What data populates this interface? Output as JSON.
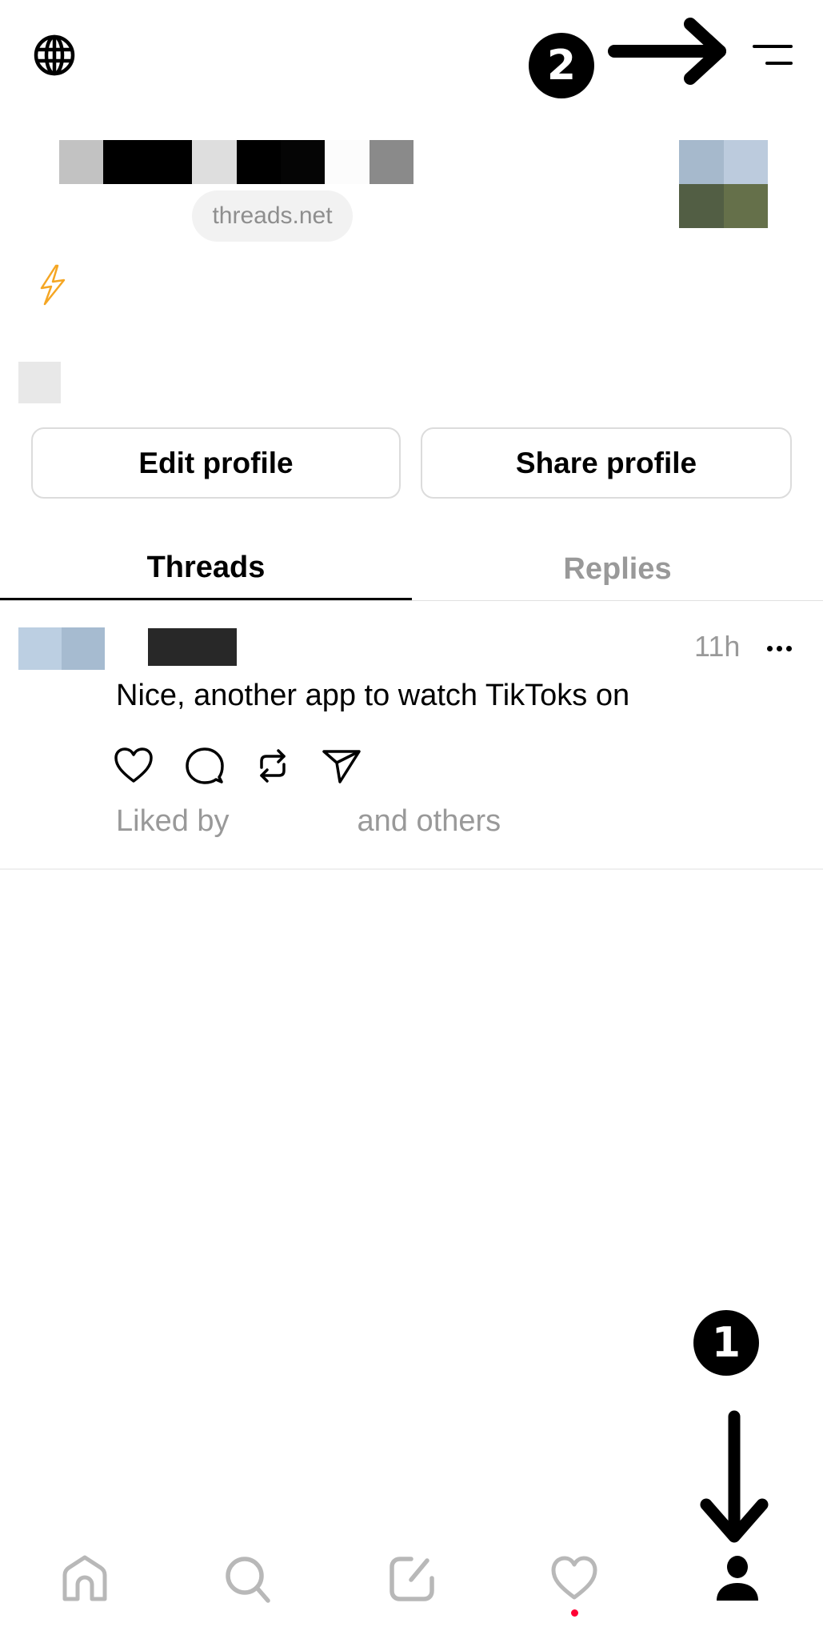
{
  "header": {
    "globe_icon": "globe-icon",
    "menu_icon": "menu-icon"
  },
  "profile": {
    "domain_label": "threads.net",
    "name_redacted_colors": [
      "#c2c2c2",
      "#000000",
      "#000000",
      "#dedede",
      "#000000",
      "#050505",
      "#fcfcfc",
      "#8a8a8a"
    ],
    "avatar_colors": [
      "#a6b9cc",
      "#bccbdd",
      "#525e44",
      "#65704a"
    ],
    "bio_emoji": "⚡",
    "edit_button": "Edit profile",
    "share_button": "Share profile"
  },
  "tabs": [
    {
      "label": "Threads",
      "active": true
    },
    {
      "label": "Replies",
      "active": false
    }
  ],
  "post": {
    "avatar_colors": [
      "#bccfe2",
      "#a6bbd0"
    ],
    "time": "11h",
    "text": "Nice, another app to watch TikToks on",
    "liked_by_prefix": "Liked by",
    "liked_by_suffix": "and others",
    "actions": [
      "like",
      "reply",
      "repost",
      "share"
    ]
  },
  "annotations": {
    "badge_1": "1",
    "badge_2": "2"
  },
  "nav": {
    "items": [
      "home",
      "search",
      "compose",
      "activity",
      "profile"
    ],
    "active": "profile",
    "activity_has_notification": true,
    "inactive_color": "#b8b8b8",
    "active_color": "#000000",
    "notification_color": "#ff0034"
  }
}
